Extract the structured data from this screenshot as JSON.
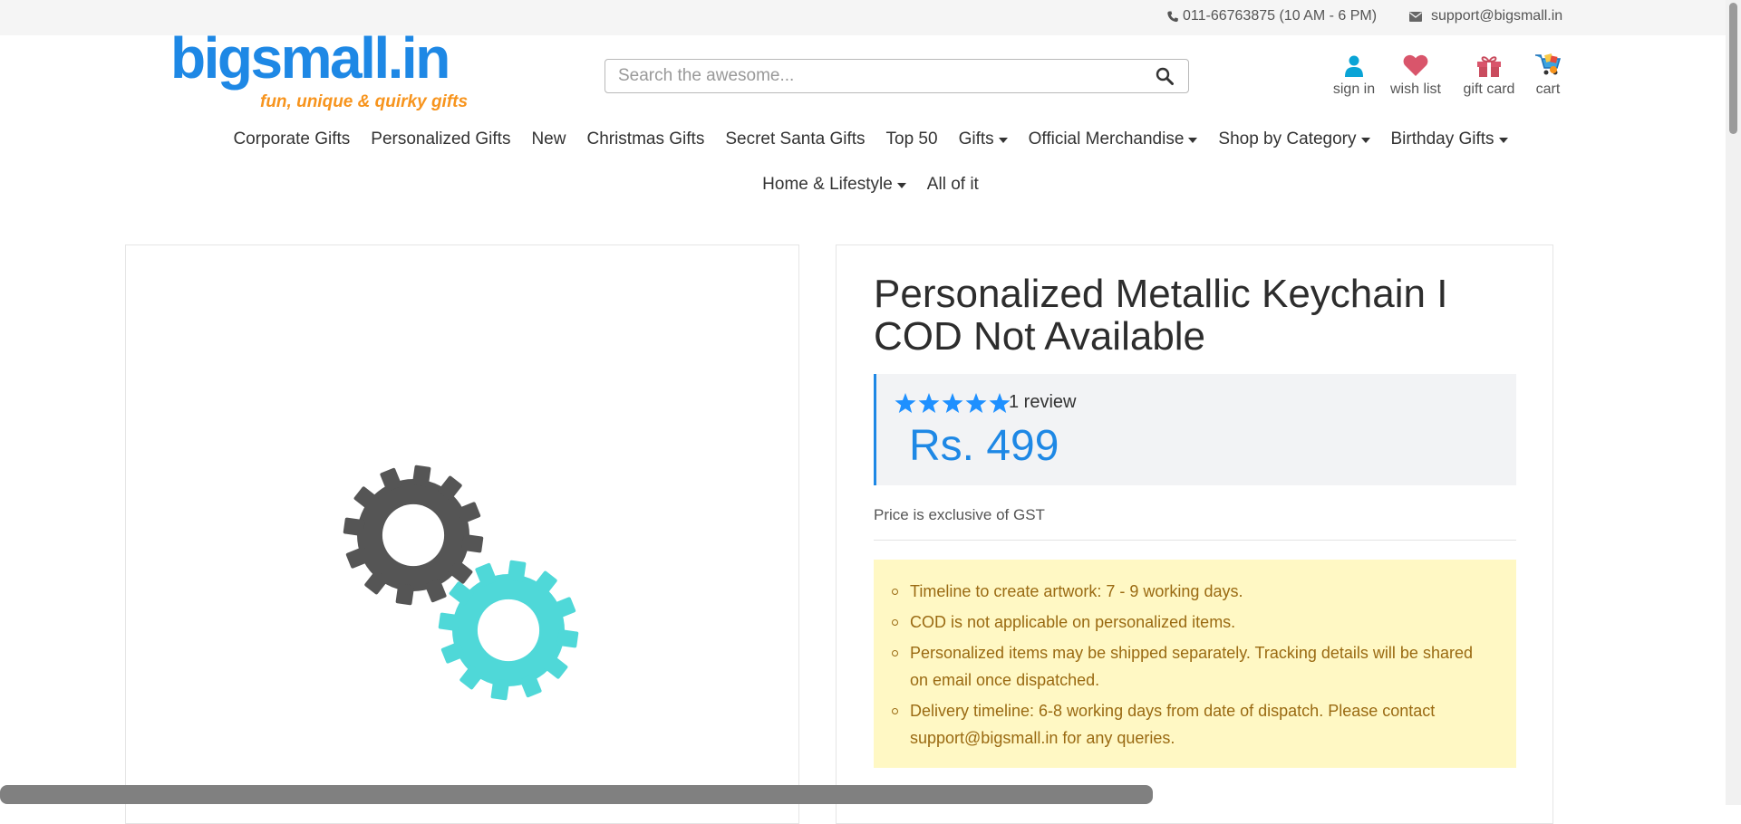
{
  "topbar": {
    "phone": "011-66763875 (10 AM - 6 PM)",
    "email": "support@bigsmall.in",
    "phone_icon": "phone-icon",
    "email_icon": "envelope-icon"
  },
  "logo": {
    "wordmark": "bigsmall.in",
    "tagline": "fun, unique & quirky gifts"
  },
  "search": {
    "placeholder": "Search the awesome...",
    "value": "",
    "icon": "search-icon"
  },
  "header_links": [
    {
      "label": "sign in",
      "icon": "user-icon"
    },
    {
      "label": "wish list",
      "icon": "heart-icon"
    },
    {
      "label": "gift card",
      "icon": "gift-icon"
    },
    {
      "label": "cart",
      "icon": "cart-icon"
    }
  ],
  "nav": {
    "row1": [
      {
        "label": "Corporate Gifts",
        "dropdown": false
      },
      {
        "label": "Personalized Gifts",
        "dropdown": false
      },
      {
        "label": "New",
        "dropdown": false
      },
      {
        "label": "Christmas Gifts",
        "dropdown": false
      },
      {
        "label": "Secret Santa Gifts",
        "dropdown": false
      },
      {
        "label": "Top 50",
        "dropdown": false
      },
      {
        "label": "Gifts",
        "dropdown": true
      },
      {
        "label": "Official Merchandise",
        "dropdown": true
      },
      {
        "label": "Shop by Category",
        "dropdown": true
      },
      {
        "label": "Birthday Gifts",
        "dropdown": true
      }
    ],
    "row2": [
      {
        "label": "Home & Lifestyle",
        "dropdown": true
      },
      {
        "label": "All of it",
        "dropdown": false
      }
    ]
  },
  "product": {
    "image_placeholder_icon": "loading-gears-icon",
    "title": "Personalized Metallic Keychain I COD Not Available",
    "rating": 5,
    "reviews": "1 review",
    "price": "Rs. 499",
    "tax_note": "Price is exclusive of GST",
    "notes": [
      "Timeline to create artwork: 7 - 9 working days.",
      "COD is not applicable on personalized items.",
      "Personalized items may be shipped separately. Tracking details will be shared on email once dispatched.",
      "Delivery timeline: 6-8 working days from date of dispatch. Please contact support@bigsmall.in for any queries."
    ]
  },
  "colors": {
    "accent": "#1e88e5",
    "star": "#1e90ff",
    "logo_tagline": "#f7941d",
    "notice_bg": "#fff8c4",
    "notice_text": "#9a6a12",
    "gear_dark": "#555555",
    "gear_teal": "#4fd8d8"
  }
}
